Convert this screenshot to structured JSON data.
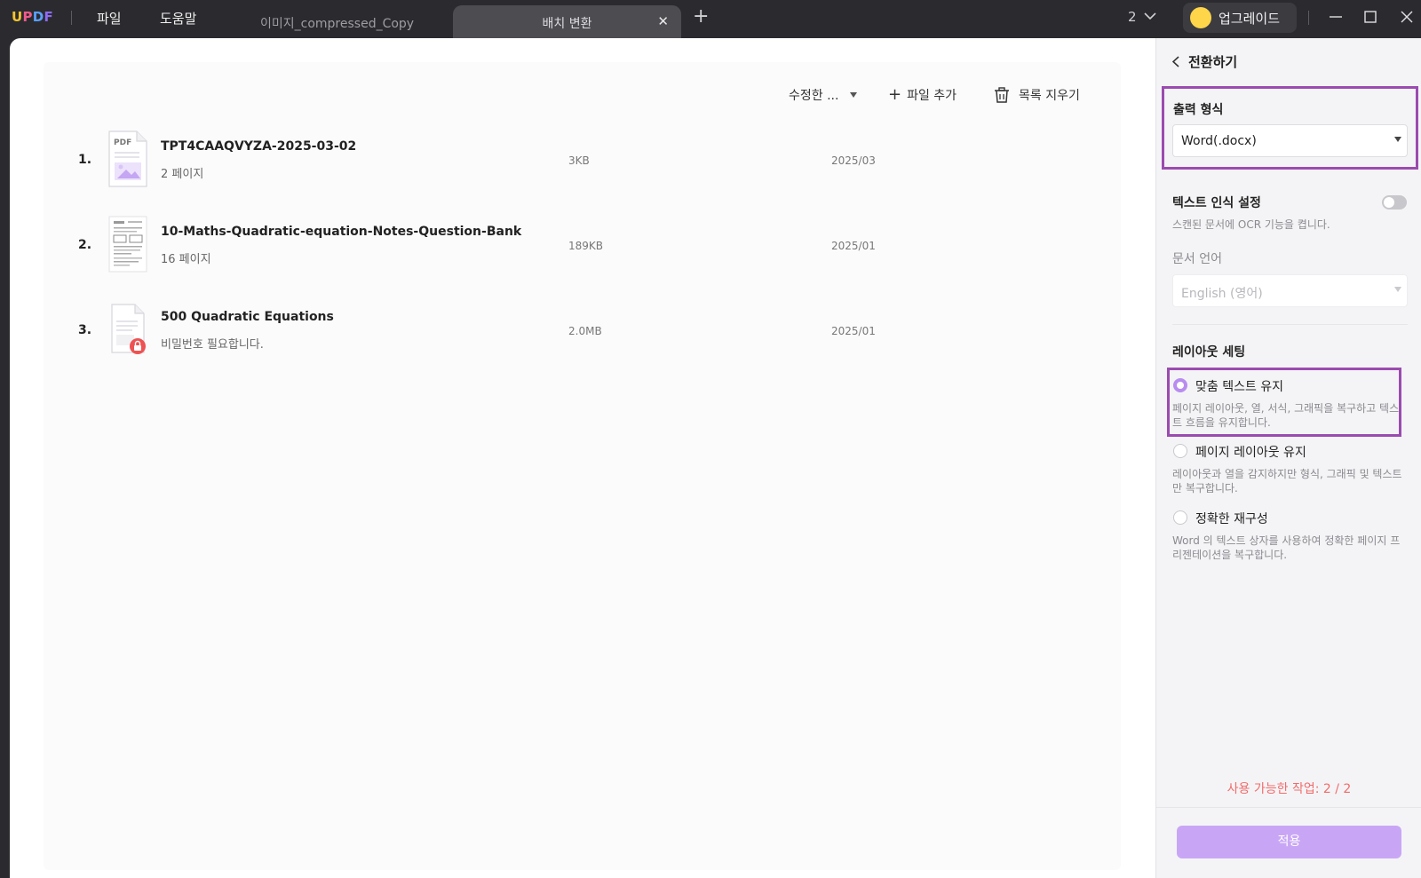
{
  "app": {
    "logo_letters": [
      "U",
      "P",
      "D",
      "F"
    ],
    "menu": [
      "파일",
      "도움말"
    ]
  },
  "tabs": [
    {
      "label": "이미지_compressed_Copy",
      "active": false
    },
    {
      "label": "배치 변환",
      "active": true
    }
  ],
  "window": {
    "count": "2",
    "upgrade_label": "업그레이드"
  },
  "toolbar": {
    "sort_label": "수정한 ...",
    "add_file_label": "파일 추가",
    "clear_list_label": "목록 지우기"
  },
  "files": [
    {
      "num": "1.",
      "name": "TPT4CAAQVYZA-2025-03-02",
      "sub": "2 페이지",
      "size": "3KB",
      "date": "2025/03",
      "thumb": "pdf-icon"
    },
    {
      "num": "2.",
      "name": "10-Maths-Quadratic-equation-Notes-Question-Bank",
      "sub": "16 페이지",
      "size": "189KB",
      "date": "2025/01",
      "thumb": "document-thumbnail"
    },
    {
      "num": "3.",
      "name": "500 Quadratic Equations",
      "sub": "비밀번호 필요합니다.",
      "size": "2.0MB",
      "date": "2025/01",
      "thumb": "locked-document-icon"
    }
  ],
  "panel": {
    "back_label": "전환하기",
    "output_format_title": "출력 형식",
    "output_format_value": "Word(.docx)",
    "ocr_title": "텍스트 인식 설정",
    "ocr_hint": "스캔된 문서에 OCR 기능을 켭니다.",
    "ocr_enabled": false,
    "doc_language_label": "문서 언어",
    "doc_language_value": "English (영어)",
    "layout_title": "레이아웃 세팅",
    "layout_options": [
      {
        "label": "맞춤 텍스트 유지",
        "hint": "페이지 레이아웃, 열, 서식, 그래픽을 복구하고 텍스트 흐름을 유지합니다.",
        "checked": true
      },
      {
        "label": "페이지 레이아웃 유지",
        "hint": "레이아웃과 열을 감지하지만 형식, 그래픽 및 텍스트만 복구합니다.",
        "checked": false
      },
      {
        "label": "정확한 재구성",
        "hint": "Word 의 텍스트 상자를 사용하여 정확한 페이지 프리젠테이션을 복구합니다.",
        "checked": false
      }
    ],
    "quota_text": "사용 가능한 작업: 2 / 2",
    "apply_label": "적용"
  },
  "colors": {
    "highlight_border": "#9b4bb0",
    "accent": "#b98cf0",
    "apply_button": "#c9a6f5",
    "quota_text": "#f26b6b"
  }
}
